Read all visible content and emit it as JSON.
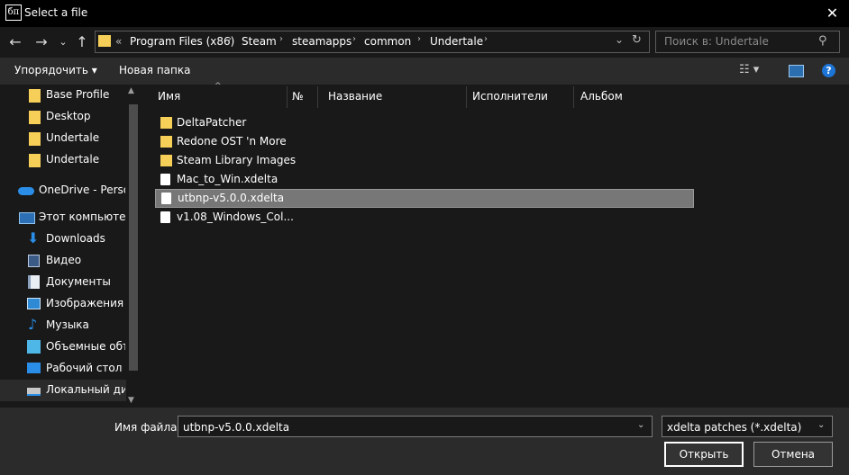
{
  "window": {
    "app_icon": "бп",
    "title": "Select a file",
    "close": "✕"
  },
  "nav": {
    "back": "←",
    "forward": "→",
    "recent": "⌄",
    "up": "↑",
    "overflow": "«",
    "breadcrumbs": [
      "Program Files (x86)",
      "Steam",
      "steamapps",
      "common",
      "Undertale"
    ],
    "dropdown": "⌄",
    "refresh": "↻",
    "search_placeholder": "Поиск в: Undertale"
  },
  "toolbar": {
    "organize": "Упорядочить ▾",
    "new_folder": "Новая папка"
  },
  "sidebar": {
    "items": [
      {
        "label": "Base Profile",
        "icon": "folder-icon"
      },
      {
        "label": "Desktop",
        "icon": "folder-icon"
      },
      {
        "label": "Undertale",
        "icon": "folder-icon"
      },
      {
        "label": "Undertale",
        "icon": "folder-icon"
      },
      {
        "label": "OneDrive - Personal",
        "icon": "cloud-icon"
      },
      {
        "label": "Этот компьютер",
        "icon": "computer-icon"
      },
      {
        "label": "Downloads",
        "icon": "download-icon"
      },
      {
        "label": "Видео",
        "icon": "video-icon"
      },
      {
        "label": "Документы",
        "icon": "documents-icon"
      },
      {
        "label": "Изображения",
        "icon": "pictures-icon"
      },
      {
        "label": "Музыка",
        "icon": "music-icon"
      },
      {
        "label": "Объемные объекты",
        "icon": "3d-objects-icon"
      },
      {
        "label": "Рабочий стол",
        "icon": "desktop-icon"
      },
      {
        "label": "Локальный диск",
        "icon": "drive-icon"
      }
    ]
  },
  "columns": [
    "Имя",
    "№",
    "Название",
    "Исполнители",
    "Альбом"
  ],
  "files": [
    {
      "name": "DeltaPatcher",
      "type": "folder"
    },
    {
      "name": "Redone OST 'n More",
      "type": "folder"
    },
    {
      "name": "Steam Library Images",
      "type": "folder"
    },
    {
      "name": "Mac_to_Win.xdelta",
      "type": "file"
    },
    {
      "name": "utbnp-v5.0.0.xdelta",
      "type": "file",
      "selected": true
    },
    {
      "name": "v1.08_Windows_Col...",
      "type": "file"
    }
  ],
  "footer": {
    "filename_label": "Имя файла:",
    "filename_value": "utbnp-v5.0.0.xdelta",
    "filetype_value": "xdelta patches (*.xdelta)",
    "open": "Открыть",
    "cancel": "Отмена"
  },
  "colors": {
    "folder": "#f6cf59",
    "selection": "#777777",
    "accent": "#1e74d6"
  }
}
